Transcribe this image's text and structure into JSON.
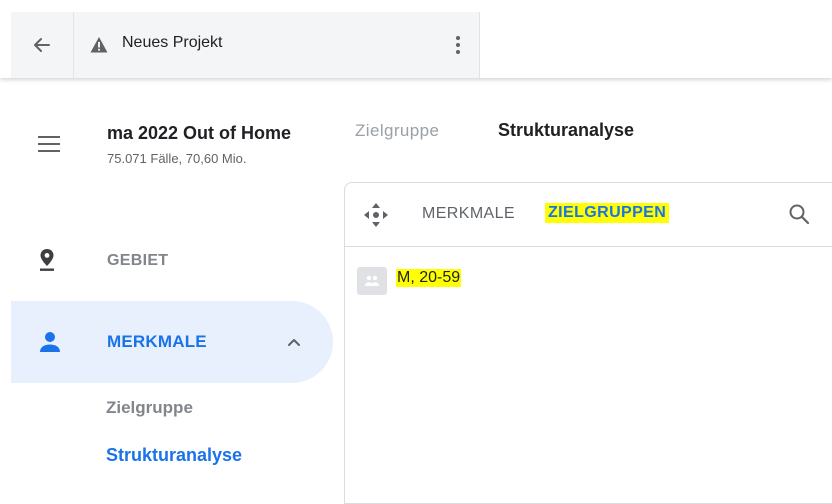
{
  "topbar": {
    "back_icon": "arrow-left-icon",
    "warning_icon": "warning-triangle-icon",
    "project_title": "Neues Projekt",
    "menu_icon": "more-vert-icon"
  },
  "study": {
    "name": "ma 2022 Out of Home",
    "subtitle": "75.071 Fälle, 70,60 Mio."
  },
  "sidebar": {
    "menu_icon": "hamburger-menu-icon",
    "items": [
      {
        "label": "GEBIET",
        "icon": "location-pin-icon"
      },
      {
        "label": "MERKMALE",
        "icon": "person-icon",
        "expanded": true
      }
    ],
    "subitems": [
      {
        "label": "Zielgruppe"
      },
      {
        "label": "Strukturanalyse",
        "active": true
      }
    ]
  },
  "main": {
    "tabs": [
      {
        "label": "Zielgruppe"
      },
      {
        "label": "Strukturanalyse",
        "active": true
      }
    ],
    "panel": {
      "move_icon": "move-arrows-icon",
      "tabs": [
        {
          "label": "MERKMALE"
        },
        {
          "label": "ZIELGRUPPEN",
          "active": true,
          "highlighted": true
        }
      ],
      "search_icon": "search-icon",
      "items": [
        {
          "label": "M, 20-59",
          "icon": "group-icon",
          "highlighted": true
        }
      ]
    }
  },
  "colors": {
    "accent": "#1a73e8",
    "active_bg": "#e8f0fe",
    "highlight": "#ffff00",
    "muted": "#80868b"
  }
}
